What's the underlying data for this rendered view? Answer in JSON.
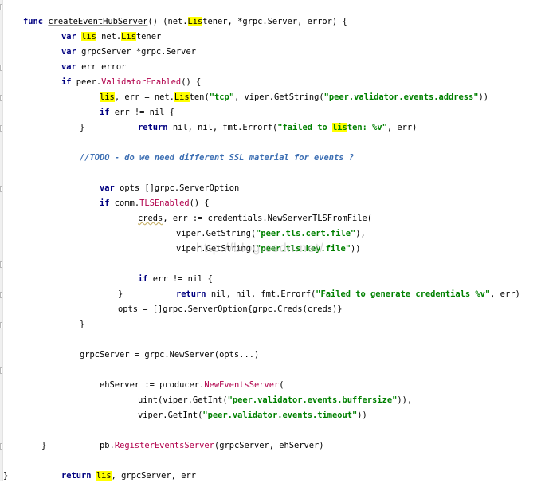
{
  "editor": {
    "language": "Go",
    "function_name": "createEventHubServer",
    "watermark": "http://blog.csdn.net/",
    "highlighted_identifier": "lis",
    "colors": {
      "keyword": "#000080",
      "string": "#008000",
      "function_call": "#b1004b",
      "comment": "#3d6fb3",
      "highlight": "#ffff00"
    }
  },
  "code": {
    "l1a": "func",
    "l1b": "createEventHubServer",
    "l1c": "() (net.",
    "l1d": "Lis",
    "l1e": "tener, *grpc.Server, error) {",
    "l2a": "var",
    "l2b": "lis",
    "l2c": " net.",
    "l2d": "Lis",
    "l2e": "tener",
    "l3a": "var",
    "l3b": " grpcServer *grpc.Server",
    "l4a": "var",
    "l4b": " err error",
    "l5a": "if",
    "l5b": " peer.",
    "l5c": "ValidatorEnabled",
    "l5d": "() {",
    "l6a": "lis",
    "l6b": ", err = net.",
    "l6c": "Lis",
    "l6d": "ten(",
    "l6e": "\"tcp\"",
    "l6f": ", viper.GetString(",
    "l6g": "\"peer.validator.events.address\"",
    "l6h": "))",
    "l7a": "if",
    "l7b": " err != nil {",
    "l8a": "return",
    "l8b": " nil, nil, fmt.Errorf(",
    "l8c": "\"failed to ",
    "l8d": "lis",
    "l8e": "ten: %v\"",
    "l8f": ", err)",
    "l9": "}",
    "l10": "//TODO - do we need different SSL material for events ?",
    "l11a": "var",
    "l11b": " opts []grpc.ServerOption",
    "l12a": "if",
    "l12b": " comm.",
    "l12c": "TLSEnabled",
    "l12d": "() {",
    "l13a": "creds",
    "l13b": ", err := credentials.NewServerTLSFromFile(",
    "l14a": "viper.GetString(",
    "l14b": "\"peer.tls.cert.file\"",
    "l14c": "),",
    "l15a": "viper.GetString(",
    "l15b": "\"peer.tls.key.file\"",
    "l15c": "))",
    "l16a": "if",
    "l16b": " err != nil {",
    "l17a": "return",
    "l17b": " nil, nil, fmt.Errorf(",
    "l17c": "\"Failed to generate credentials %v\"",
    "l17d": ", err)",
    "l18": "}",
    "l19": "opts = []grpc.ServerOption{grpc.Creds(creds)}",
    "l20": "}",
    "l21": "grpcServer = grpc.NewServer(opts...)",
    "l22a": "ehServer := producer.",
    "l22b": "NewEventsServer",
    "l22c": "(",
    "l23a": "uint(viper.GetInt(",
    "l23b": "\"peer.validator.events.buffersize\"",
    "l23c": ")),",
    "l24a": "viper.GetInt(",
    "l24b": "\"peer.validator.events.timeout\"",
    "l24c": "))",
    "l25a": "pb.",
    "l25b": "RegisterEventsServer",
    "l25c": "(grpcServer, ehServer)",
    "l26": "}",
    "l27a": "return",
    "l27b": "lis",
    "l27c": ", grpcServer, err",
    "l28": "}"
  }
}
